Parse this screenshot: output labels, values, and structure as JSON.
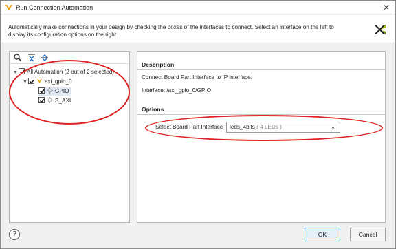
{
  "window": {
    "title": "Run Connection Automation"
  },
  "header": {
    "description": "Automatically make connections in your design by checking the boxes of the interfaces to connect. Select an interface on the left to display its configuration options on the right."
  },
  "tree": {
    "root": {
      "label": "All Automation (2 out of 2 selected)",
      "checked": true,
      "expanded": true
    },
    "ip": {
      "label": "axi_gpio_0",
      "checked": true,
      "expanded": true
    },
    "interfaces": [
      {
        "label": "GPIO",
        "checked": true,
        "selected": true
      },
      {
        "label": "S_AXI",
        "checked": true,
        "selected": false
      }
    ]
  },
  "details": {
    "description_heading": "Description",
    "description_text": "Connect Board Part Interface to IP interface.",
    "interface_text": "Interface: /axi_gpio_0/GPIO",
    "options_heading": "Options",
    "bpi_label": "Select Board Part Interface",
    "bpi_value": "leds_4bits",
    "bpi_value_detail": "( 4 LEDs )"
  },
  "footer": {
    "help_label": "?",
    "ok_label": "OK",
    "cancel_label": "Cancel"
  },
  "colors": {
    "annotation": "#e02020",
    "accent": "#3d86d1",
    "selection": "#dfe9f5",
    "gpio_icon": "#e8a000"
  }
}
